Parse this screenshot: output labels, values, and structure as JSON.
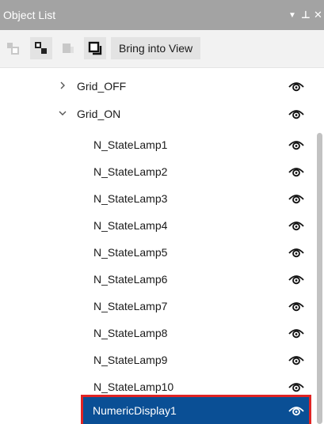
{
  "title": "Object List",
  "title_controls": {
    "dropdown": "▼",
    "pin": "⊥",
    "close": "✕"
  },
  "toolbar": {
    "bring_into_view_label": "Bring into View"
  },
  "tree": {
    "groups": [
      {
        "label": "Grid_OFF",
        "expanded": false
      },
      {
        "label": "Grid_ON",
        "expanded": true
      }
    ],
    "children": [
      "N_StateLamp1",
      "N_StateLamp2",
      "N_StateLamp3",
      "N_StateLamp4",
      "N_StateLamp5",
      "N_StateLamp6",
      "N_StateLamp7",
      "N_StateLamp8",
      "N_StateLamp9",
      "N_StateLamp10"
    ],
    "selected_item": "NumericDisplay1"
  },
  "colors": {
    "titlebar": "#a3a3a3",
    "selection": "#0a4f95",
    "highlight_border": "#e02424"
  }
}
